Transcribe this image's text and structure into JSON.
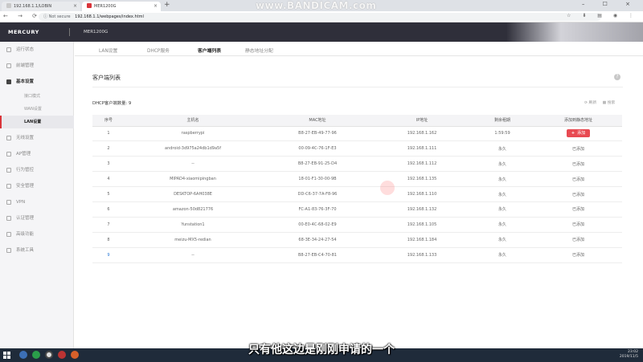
{
  "browser": {
    "tabs": [
      {
        "title": "192.168.1.1/LOBIN",
        "close": "×"
      },
      {
        "title": "MER1200G",
        "close": "×"
      }
    ],
    "new_tab": "+",
    "window_controls": "– ☐ ×",
    "watermark": "www.BANDICAM.com",
    "nav_controls": "← → ⟳",
    "security": "ⓘ Not secure",
    "url": "192.168.1.1/webpages/index.html",
    "ext_icons": "☆ ⬇ ▤ ◉ ⋮"
  },
  "header": {
    "brand": "MERCURY",
    "model": "MER1200G"
  },
  "sidebar": {
    "items": [
      {
        "label": "运行状态",
        "icon": "status-icon"
      },
      {
        "label": "前端管理",
        "icon": "manage-icon"
      },
      {
        "label": "基本设置",
        "icon": "gear-icon"
      },
      {
        "label": "无线设置",
        "icon": "wifi-icon"
      },
      {
        "label": "AP管理",
        "icon": "ap-icon"
      },
      {
        "label": "行为管控",
        "icon": "control-icon"
      },
      {
        "label": "安全管理",
        "icon": "shield-icon"
      },
      {
        "label": "VPN",
        "icon": "vpn-icon"
      },
      {
        "label": "认证管理",
        "icon": "auth-icon"
      },
      {
        "label": "高级功能",
        "icon": "advanced-icon"
      },
      {
        "label": "系统工具",
        "icon": "tools-icon"
      }
    ],
    "sub_items": [
      "接口模式",
      "WAN设置",
      "LAN设置"
    ]
  },
  "subtabs": [
    "LAN设置",
    "DHCP服务",
    "客户端列表",
    "静态地址分配"
  ],
  "section": {
    "title": "客户端列表",
    "help": "?",
    "count_label": "DHCP客户端数量: 9",
    "refresh": "⟳ 刷新",
    "search": "▦ 搜索"
  },
  "table": {
    "headers": [
      "序号",
      "主机名",
      "MAC地址",
      "IP地址",
      "剩余租期",
      "添加到静态地址"
    ],
    "rows": [
      {
        "idx": "1",
        "host": "raspberrypi",
        "mac": "B8-27-EB-49-77-96",
        "ip": "192.168.1.162",
        "lease": "1:59:59",
        "action": "添加",
        "button": true
      },
      {
        "idx": "2",
        "host": "android-3d975a24db1d9a5f",
        "mac": "00-09-4C-76-1F-E3",
        "ip": "192.168.1.111",
        "lease": "永久",
        "action": "已添加",
        "button": false
      },
      {
        "idx": "3",
        "host": "--",
        "mac": "B8-27-EB-91-25-D4",
        "ip": "192.168.1.112",
        "lease": "永久",
        "action": "已添加",
        "button": false
      },
      {
        "idx": "4",
        "host": "MIPAD4-xiaomipingban",
        "mac": "18-01-F1-30-00-9B",
        "ip": "192.168.1.135",
        "lease": "永久",
        "action": "已添加",
        "button": false
      },
      {
        "idx": "5",
        "host": "DESKTOP-6AH038E",
        "mac": "DD-C6-37-7A-F8-96",
        "ip": "192.168.1.110",
        "lease": "永久",
        "action": "已添加",
        "button": false
      },
      {
        "idx": "6",
        "host": "amazon-50d821776",
        "mac": "FC-A1-83-76-3F-70",
        "ip": "192.168.1.132",
        "lease": "永久",
        "action": "已添加",
        "button": false
      },
      {
        "idx": "7",
        "host": "Yunstation1",
        "mac": "00-E0-4C-68-02-E9",
        "ip": "192.168.1.105",
        "lease": "永久",
        "action": "已添加",
        "button": false
      },
      {
        "idx": "8",
        "host": "meizu-MX5-redian",
        "mac": "68-3E-34-24-27-54",
        "ip": "192.168.1.184",
        "lease": "永久",
        "action": "已添加",
        "button": false
      },
      {
        "idx": "9",
        "host": "--",
        "mac": "B8-27-EB-C4-70-81",
        "ip": "192.168.1.133",
        "lease": "永久",
        "action": "已添加",
        "button": false
      }
    ]
  },
  "subtitle": "只有他这边是刚刚申请的一个",
  "taskbar": {
    "time": "23:02",
    "date": "2019/11/5"
  },
  "colors": {
    "header_bg": "#2f2f3a",
    "accent_red": "#e84a52",
    "active_marker": "#d9343a"
  }
}
